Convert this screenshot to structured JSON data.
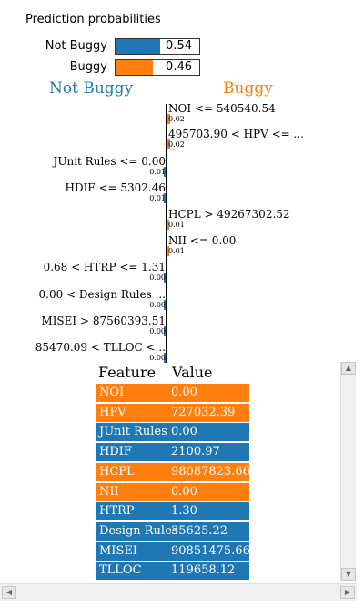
{
  "title": "Prediction probabilities",
  "probabilities": [
    {
      "label": "Not Buggy",
      "value": "0.54",
      "fraction": 0.54,
      "color": "#1f77b4"
    },
    {
      "label": "Buggy",
      "value": "0.46",
      "fraction": 0.46,
      "color": "#ff7f0e"
    }
  ],
  "headers": {
    "left": "Not Buggy",
    "right": "Buggy",
    "left_color": "#1f77b4",
    "right_color": "#ff7f0e"
  },
  "features": [
    {
      "text": "NOI <= 540540.54",
      "weight": "0.02",
      "side": "right"
    },
    {
      "text": "495703.90 < HPV <= ...",
      "weight": "0.02",
      "side": "right"
    },
    {
      "text": "JUnit Rules <= 0.00",
      "weight": "0.01",
      "side": "left"
    },
    {
      "text": "HDIF <= 5302.46",
      "weight": "0.01",
      "side": "left"
    },
    {
      "text": "HCPL > 49267302.52",
      "weight": "0.01",
      "side": "right"
    },
    {
      "text": "NII <= 0.00",
      "weight": "0.01",
      "side": "right"
    },
    {
      "text": "0.68 < HTRP <= 1.31",
      "weight": "0.00",
      "side": "left"
    },
    {
      "text": "0.00 < Design Rules ...",
      "weight": "0.00",
      "side": "left"
    },
    {
      "text": "MISEI > 87560393.51",
      "weight": "0.00",
      "side": "left"
    },
    {
      "text": "85470.09 < TLLOC <...",
      "weight": "0.00",
      "side": "left"
    }
  ],
  "table": {
    "header_feature": "Feature",
    "header_value": "Value",
    "rows": [
      {
        "feature": "NOI",
        "value": "0.00",
        "side": "right"
      },
      {
        "feature": "HPV",
        "value": "727032.39",
        "side": "right"
      },
      {
        "feature": "JUnit Rules",
        "value": "0.00",
        "side": "left"
      },
      {
        "feature": "HDIF",
        "value": "2100.97",
        "side": "left"
      },
      {
        "feature": "HCPL",
        "value": "98087823.66",
        "side": "right"
      },
      {
        "feature": "NII",
        "value": "0.00",
        "side": "right"
      },
      {
        "feature": "HTRP",
        "value": "1.30",
        "side": "left"
      },
      {
        "feature": "Design Rules",
        "value": "35625.22",
        "side": "left"
      },
      {
        "feature": "MISEI",
        "value": "90851475.66",
        "side": "left"
      },
      {
        "feature": "TLLOC",
        "value": "119658.12",
        "side": "left"
      }
    ]
  },
  "icons": {
    "scroll_up": "triangle-up",
    "scroll_down": "triangle-down",
    "scroll_left": "triangle-left",
    "scroll_right": "triangle-right"
  }
}
